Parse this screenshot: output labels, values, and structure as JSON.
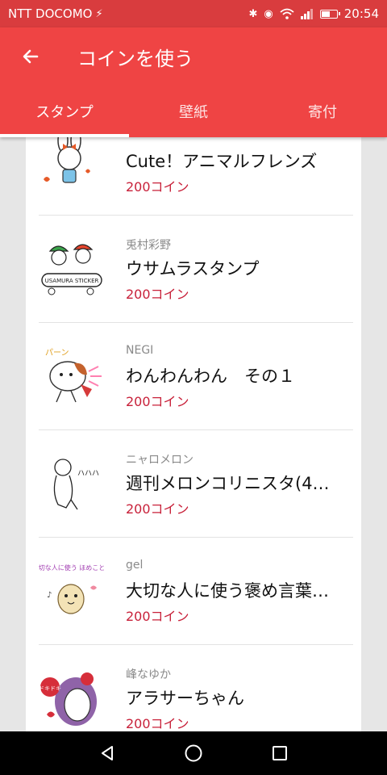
{
  "status_bar": {
    "carrier": "NTT DOCOMO",
    "time": "20:54",
    "battery_level": 0.6
  },
  "app_bar": {
    "title": "コインを使う",
    "back_icon": "arrow-left-icon",
    "color": "#ef4444"
  },
  "tabs": [
    {
      "label": "スタンプ",
      "active": true
    },
    {
      "label": "壁紙",
      "active": false
    },
    {
      "label": "寄付",
      "active": false
    }
  ],
  "items": [
    {
      "author": "",
      "name": "Cute！アニマルフレンズ",
      "price": "200コイン"
    },
    {
      "author": "兎村彩野",
      "name": "ウサムラスタンプ",
      "price": "200コイン",
      "thumb_text": "USAMURA STICKER"
    },
    {
      "author": "NEGI",
      "name": "わんわんわん　その１",
      "price": "200コイン",
      "thumb_text": "パーン"
    },
    {
      "author": "ニャロメロン",
      "name": "週刊メロンコリニスタ(4…",
      "price": "200コイン",
      "thumb_text": "ハハハ"
    },
    {
      "author": "gel",
      "name": "大切な人に使う褒め言葉…",
      "price": "200コイン",
      "thumb_text": "大切な人に使う ほめことば"
    },
    {
      "author": "峰なゆか",
      "name": "アラサーちゃん",
      "price": "200コイン",
      "thumb_text": "ドキドキ"
    }
  ],
  "colors": {
    "price": "#c8213a",
    "status_bar": "#d93c3e"
  }
}
